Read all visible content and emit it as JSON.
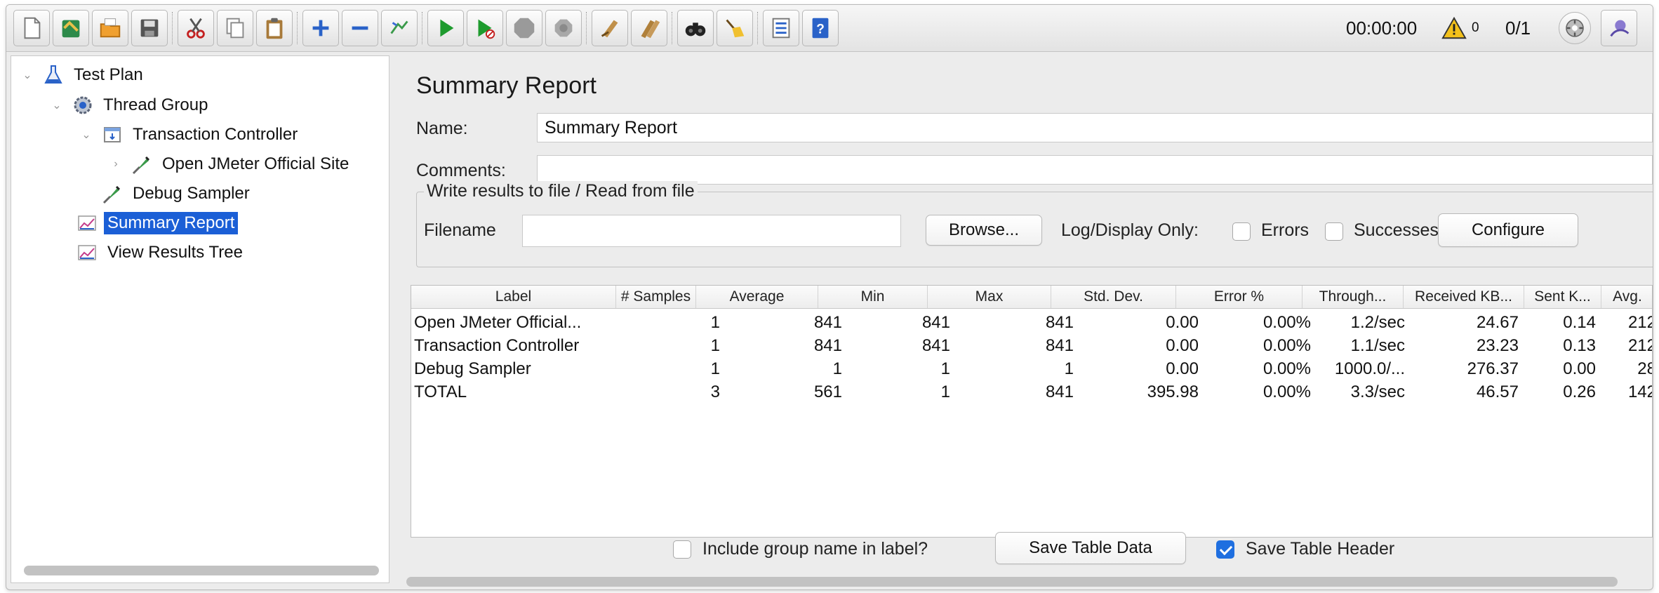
{
  "toolbar": {
    "timer": "00:00:00",
    "warning_count": "0",
    "threads": "0/1",
    "icons": [
      "new-icon",
      "templates-icon",
      "open-icon",
      "save-icon",
      "cut-icon",
      "copy-icon",
      "paste-icon",
      "expand-icon",
      "collapse-icon",
      "toggle-icon",
      "start-icon",
      "start-no-pause-icon",
      "stop-icon",
      "shutdown-icon",
      "clear-icon",
      "clear-all-icon",
      "search-icon",
      "reset-search-icon",
      "function-helper-icon",
      "help-icon",
      "warning-icon",
      "remote-icon",
      "logo-icon"
    ]
  },
  "tree": {
    "items": [
      {
        "label": "Test Plan",
        "icon": "test-plan-icon"
      },
      {
        "label": "Thread Group",
        "icon": "thread-group-icon"
      },
      {
        "label": "Transaction Controller",
        "icon": "transaction-controller-icon"
      },
      {
        "label": "Open JMeter Official Site",
        "icon": "sampler-icon"
      },
      {
        "label": "Debug Sampler",
        "icon": "sampler-icon"
      },
      {
        "label": "Summary Report",
        "icon": "listener-icon",
        "selected": true
      },
      {
        "label": "View Results Tree",
        "icon": "listener-icon"
      }
    ]
  },
  "panel": {
    "title": "Summary Report",
    "name_label": "Name:",
    "name_value": "Summary Report",
    "comments_label": "Comments:",
    "comments_value": "",
    "group_title": "Write results to file / Read from file",
    "filename_label": "Filename",
    "filename_value": "",
    "browse_label": "Browse...",
    "log_display_label": "Log/Display Only:",
    "errors_label": "Errors",
    "successes_label": "Successes",
    "configure_label": "Configure"
  },
  "table": {
    "headers": [
      "Label",
      "# Samples",
      "Average",
      "Min",
      "Max",
      "Std. Dev.",
      "Error %",
      "Through...",
      "Received KB...",
      "Sent K...",
      "Avg."
    ],
    "rows": [
      [
        "Open JMeter Official...",
        "1",
        "841",
        "841",
        "841",
        "0.00",
        "0.00%",
        "1.2/sec",
        "24.67",
        "0.14",
        "212"
      ],
      [
        "Transaction Controller",
        "1",
        "841",
        "841",
        "841",
        "0.00",
        "0.00%",
        "1.1/sec",
        "23.23",
        "0.13",
        "212"
      ],
      [
        "Debug Sampler",
        "1",
        "1",
        "1",
        "1",
        "0.00",
        "0.00%",
        "1000.0/...",
        "276.37",
        "0.00",
        "28"
      ],
      [
        "TOTAL",
        "3",
        "561",
        "1",
        "841",
        "395.98",
        "0.00%",
        "3.3/sec",
        "46.57",
        "0.26",
        "142"
      ]
    ]
  },
  "footer": {
    "include_group_label": "Include group name in label?",
    "include_group_checked": false,
    "save_table_data_label": "Save Table Data",
    "save_table_header_label": "Save Table Header",
    "save_table_header_checked": true
  },
  "colors": {
    "selection": "#1b5fd6",
    "run_green": "#1e9b2e",
    "checkbox_blue": "#1f6fe0"
  }
}
